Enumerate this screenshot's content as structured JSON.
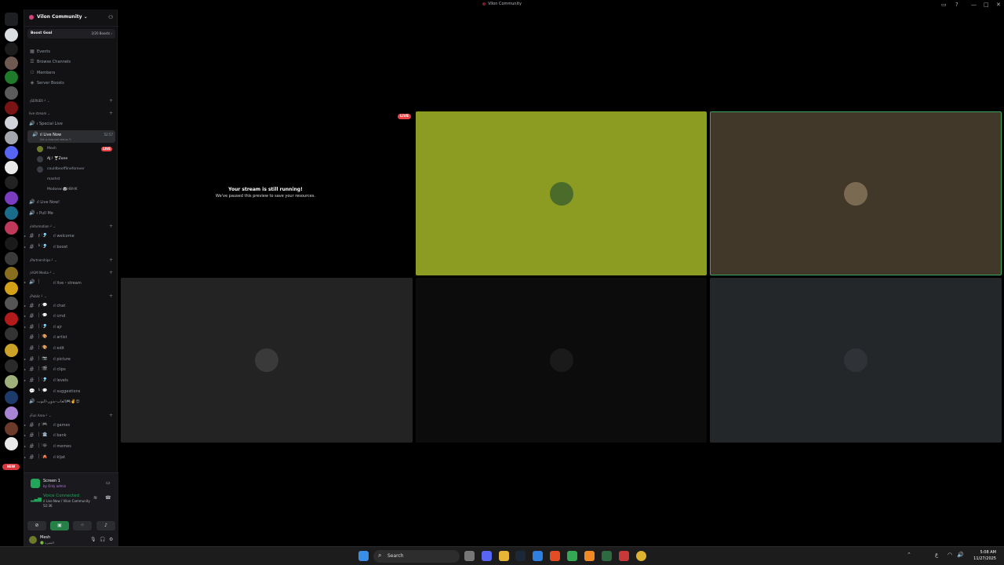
{
  "window": {
    "title": "Vilon Community",
    "controls": [
      "▭",
      "?",
      "—",
      "□",
      "✕"
    ]
  },
  "sidebar": {
    "guild_name": "Vilon Community ⌄",
    "boost_goal_label": "Boost Goal",
    "boost_count": "2/20 Boosts ›",
    "menu": [
      {
        "label": "Events",
        "icon": "calendar-icon"
      },
      {
        "label": "Browse Channels",
        "icon": "browse-icon"
      },
      {
        "label": "Members",
        "icon": "members-icon"
      },
      {
        "label": "Server Boosts",
        "icon": "boost-icon"
      }
    ],
    "categories": {
      "server": "┌SERVER ┘ ⌄",
      "live_stream": "live stream ⌄",
      "information": "┌Information ┘ ⌄",
      "partnerships": "┌Partnerships ┘ ⌄",
      "vgm_media": "┌VGM Media ┘ ⌄",
      "public": "┌Public ┘ ⌄",
      "fun_area": "┌Fun Area ┘ ⌄"
    },
    "voice_channels": {
      "special_live": "ı Special Live",
      "live_now": "ıl Live Now",
      "live_now_timer": "52:57",
      "live_now_status": "Set a channel status ✎",
      "live_now2": "ıl Live Now!",
      "pull_me": "ı Pull Me"
    },
    "users": [
      {
        "name": "Mesh",
        "live": "LIVE"
      },
      {
        "name": "AJ.! 🍸Zone"
      },
      {
        "name": "couldbeofflineforever"
      },
      {
        "name": "mashst"
      },
      {
        "name": "Modoew 🐼HBHK"
      }
    ],
    "text_channels": [
      {
        "prefix": "╔ ⁝🎐",
        "name": "ıl welcome",
        "white": true
      },
      {
        "prefix": "╚ ⁝🎐",
        "name": "ıl boost",
        "white": true
      },
      {
        "prefix": "│",
        "name": "ıl live・stream",
        "white": true
      },
      {
        "prefix": "╔ ⁝💬",
        "name": "ıl chat",
        "white": true
      },
      {
        "prefix": "│ ⁝💬",
        "name": "ıl cmd",
        "white": true
      },
      {
        "prefix": "│ ⁝🎐",
        "name": "ıl ajr",
        "white": true
      },
      {
        "prefix": "│ ⁝🎨",
        "name": "ıl artist",
        "white": false
      },
      {
        "prefix": "│ ⁝🎨",
        "name": "ıl edit",
        "white": false
      },
      {
        "prefix": "│ ⁝📷",
        "name": "ıl picture",
        "white": true
      },
      {
        "prefix": "│ ⁝🎬",
        "name": "ıl clips",
        "white": true
      },
      {
        "prefix": "│ ⁝🎐",
        "name": "ıl levels",
        "white": true
      },
      {
        "prefix": "╚ ⁝💬",
        "name": "ıl suggestions",
        "white": false
      },
      {
        "prefix": "",
        "name": "العاب-بدون-البوت🎮✌️😍",
        "white": false
      },
      {
        "prefix": "╔ ⁝🎮",
        "name": "ıl games",
        "white": true
      },
      {
        "prefix": "│ ⁝🏦",
        "name": "ıl bank",
        "white": true
      },
      {
        "prefix": "│ ⁝😂",
        "name": "ıl memes",
        "white": true
      },
      {
        "prefix": "│ ⁝🎪",
        "name": "ıl kljat",
        "white": true
      }
    ],
    "bottom": {
      "screen_title": "Screen 1",
      "screen_sub": "by Only admin",
      "voice_connected": "Voice Connected",
      "voice_path": "ıl Live Now / Vilon Community",
      "voice_time": "52:36",
      "user_name": "Mesh",
      "user_status": "🟢 السيرة"
    },
    "new_badge": "NEW"
  },
  "stage": {
    "live_badge": "LIVE",
    "paused_title": "Your stream is still running!",
    "paused_sub": "We've paused this preview to save your resources.",
    "tile_colors": [
      "#8c9c22",
      "#41382a",
      "#232323",
      "#0c0c0c",
      "#24272a"
    ]
  },
  "taskbar": {
    "search_label": "Search",
    "time": "5:08 AM",
    "date": "11/27/2025"
  }
}
